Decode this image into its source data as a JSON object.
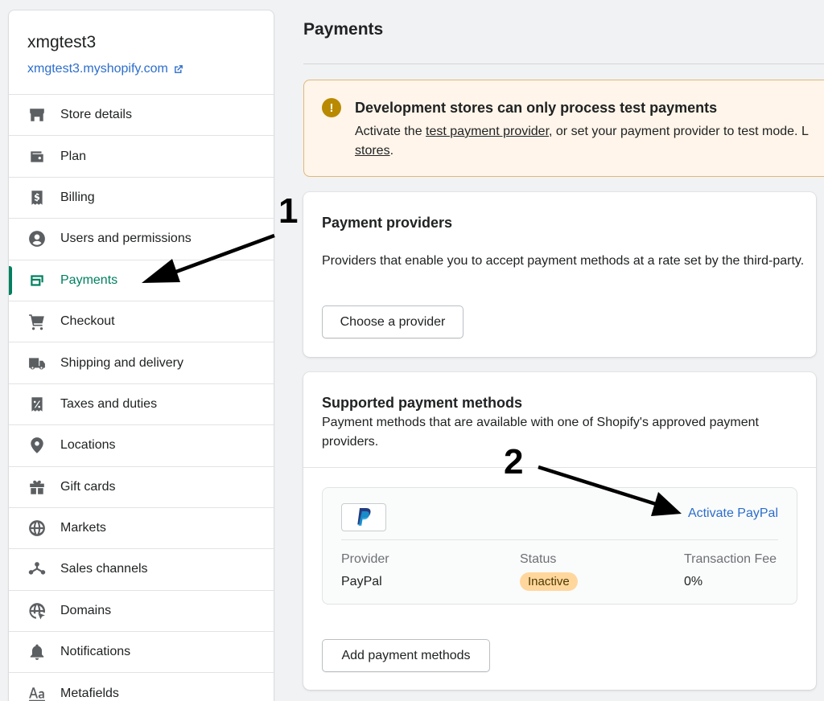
{
  "sidebar": {
    "store_name": "xmgtest3",
    "store_url": "xmgtest3.myshopify.com",
    "items": [
      {
        "label": "Store details",
        "icon": "store-icon"
      },
      {
        "label": "Plan",
        "icon": "wallet-icon"
      },
      {
        "label": "Billing",
        "icon": "receipt-dollar-icon"
      },
      {
        "label": "Users and permissions",
        "icon": "user-circle-icon"
      },
      {
        "label": "Payments",
        "icon": "payment-card-icon",
        "active": true
      },
      {
        "label": "Checkout",
        "icon": "cart-icon"
      },
      {
        "label": "Shipping and delivery",
        "icon": "truck-icon"
      },
      {
        "label": "Taxes and duties",
        "icon": "tax-receipt-icon"
      },
      {
        "label": "Locations",
        "icon": "location-pin-icon"
      },
      {
        "label": "Gift cards",
        "icon": "gift-icon"
      },
      {
        "label": "Markets",
        "icon": "globe-markets-icon"
      },
      {
        "label": "Sales channels",
        "icon": "channels-icon"
      },
      {
        "label": "Domains",
        "icon": "globe-cursor-icon"
      },
      {
        "label": "Notifications",
        "icon": "bell-icon"
      },
      {
        "label": "Metafields",
        "icon": "text-aa-icon"
      }
    ]
  },
  "page": {
    "title": "Payments"
  },
  "banner": {
    "title": "Development stores can only process test payments",
    "text_before": "Activate the ",
    "link1": "test payment provider",
    "text_middle": ", or set your payment provider to test mode. L",
    "link2": "stores",
    "text_after": "."
  },
  "providers_card": {
    "title": "Payment providers",
    "description": "Providers that enable you to accept payment methods at a rate set by the third-party.",
    "button": "Choose a provider"
  },
  "methods_card": {
    "title": "Supported payment methods",
    "description": "Payment methods that are available with one of Shopify's approved payment providers.",
    "activate_link": "Activate PayPal",
    "columns": {
      "provider": "Provider",
      "status": "Status",
      "fee": "Transaction Fee"
    },
    "row": {
      "provider": "PayPal",
      "status": "Inactive",
      "fee": "0%"
    },
    "button": "Add payment methods"
  },
  "annotations": {
    "marker1": "1",
    "marker2": "2"
  },
  "colors": {
    "accent_green": "#008060",
    "link_blue": "#2c6ecb",
    "warning_bg": "#fff5ea",
    "badge_bg": "#ffd79d"
  }
}
